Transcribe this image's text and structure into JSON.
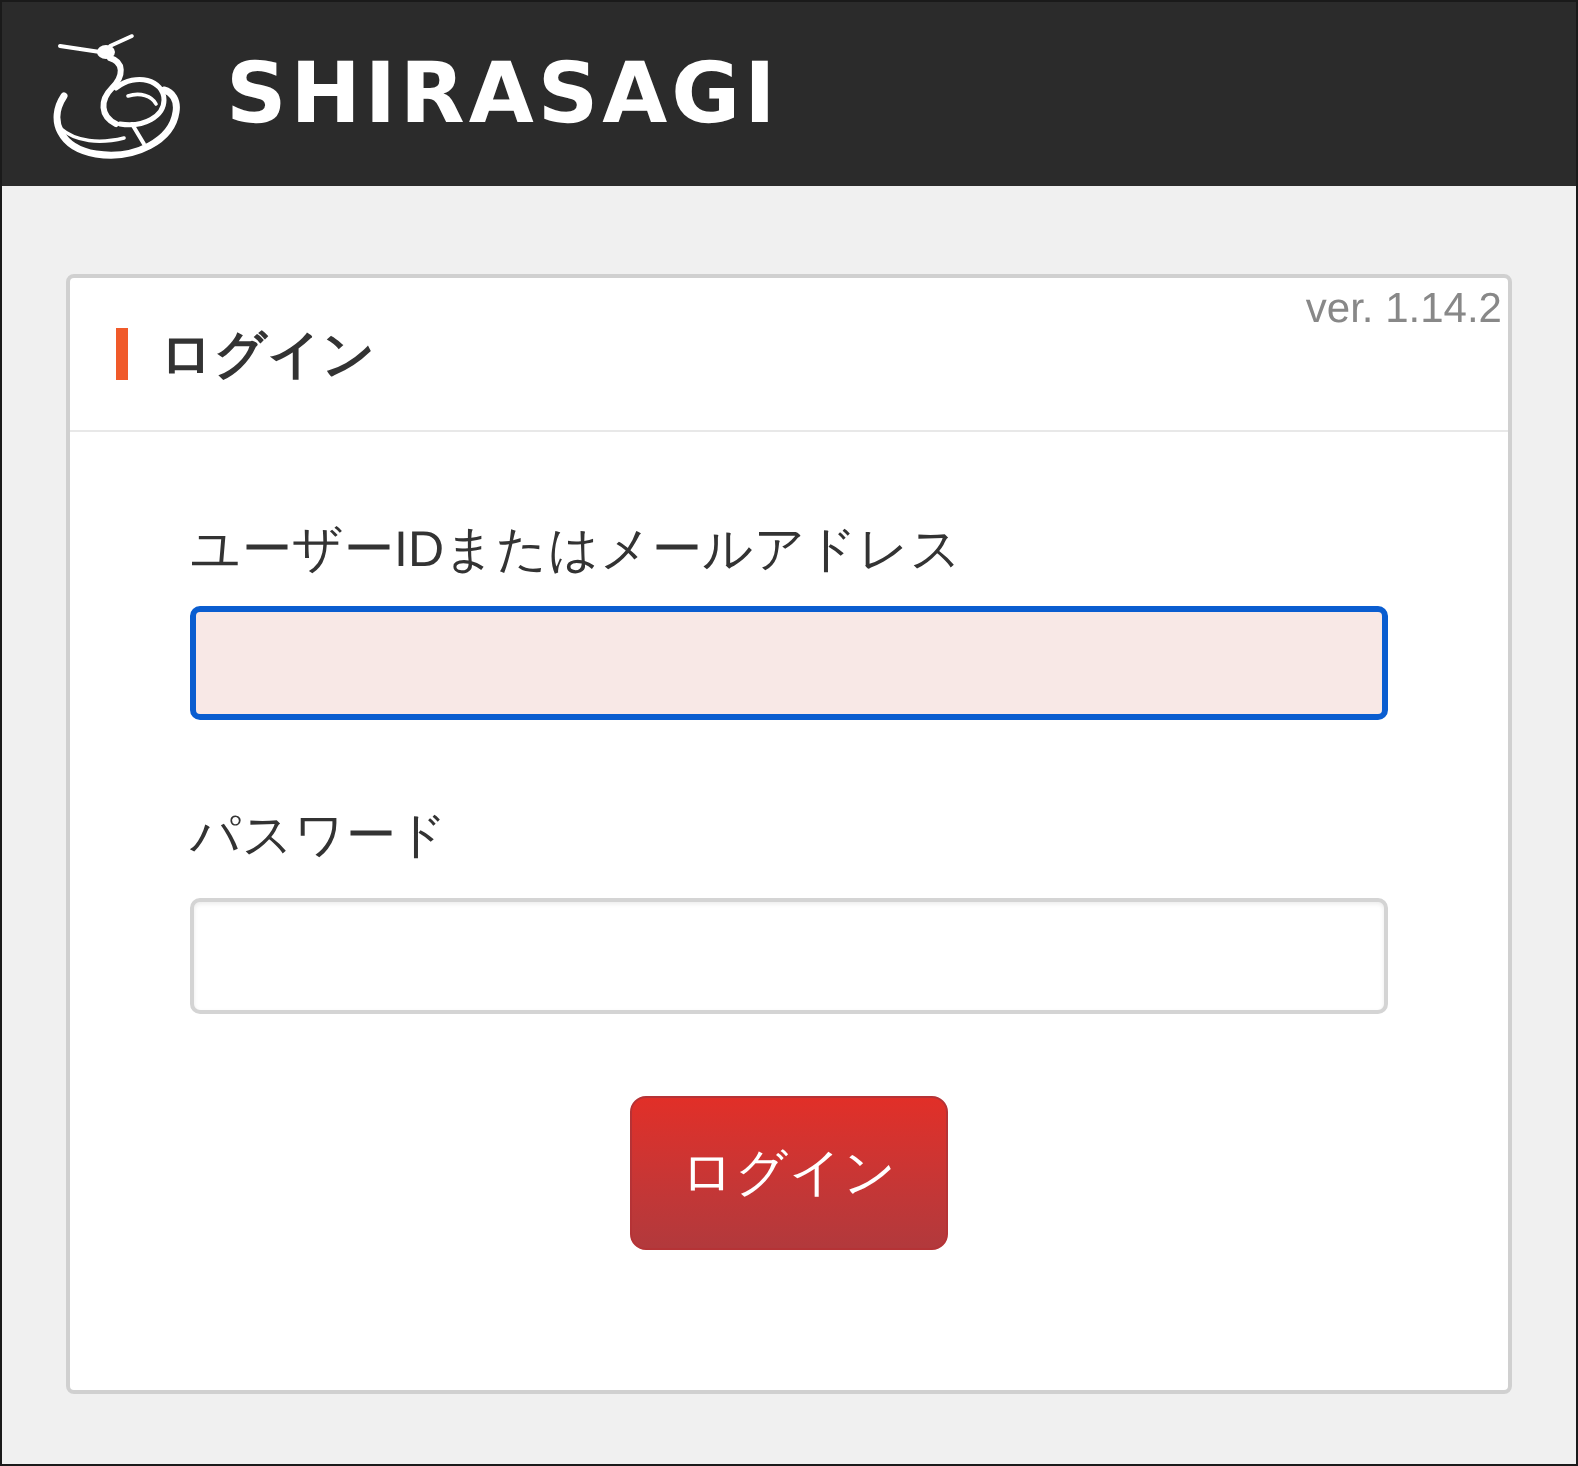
{
  "header": {
    "logo_text": "SHIRASAGI"
  },
  "login_card": {
    "title": "ログイン",
    "version": "ver. 1.14.2",
    "fields": [
      {
        "label": "ユーザーIDまたはメールアドレス",
        "focused": true
      },
      {
        "label": "パスワード",
        "focused": false
      }
    ],
    "submit_button": "ログイン"
  }
}
